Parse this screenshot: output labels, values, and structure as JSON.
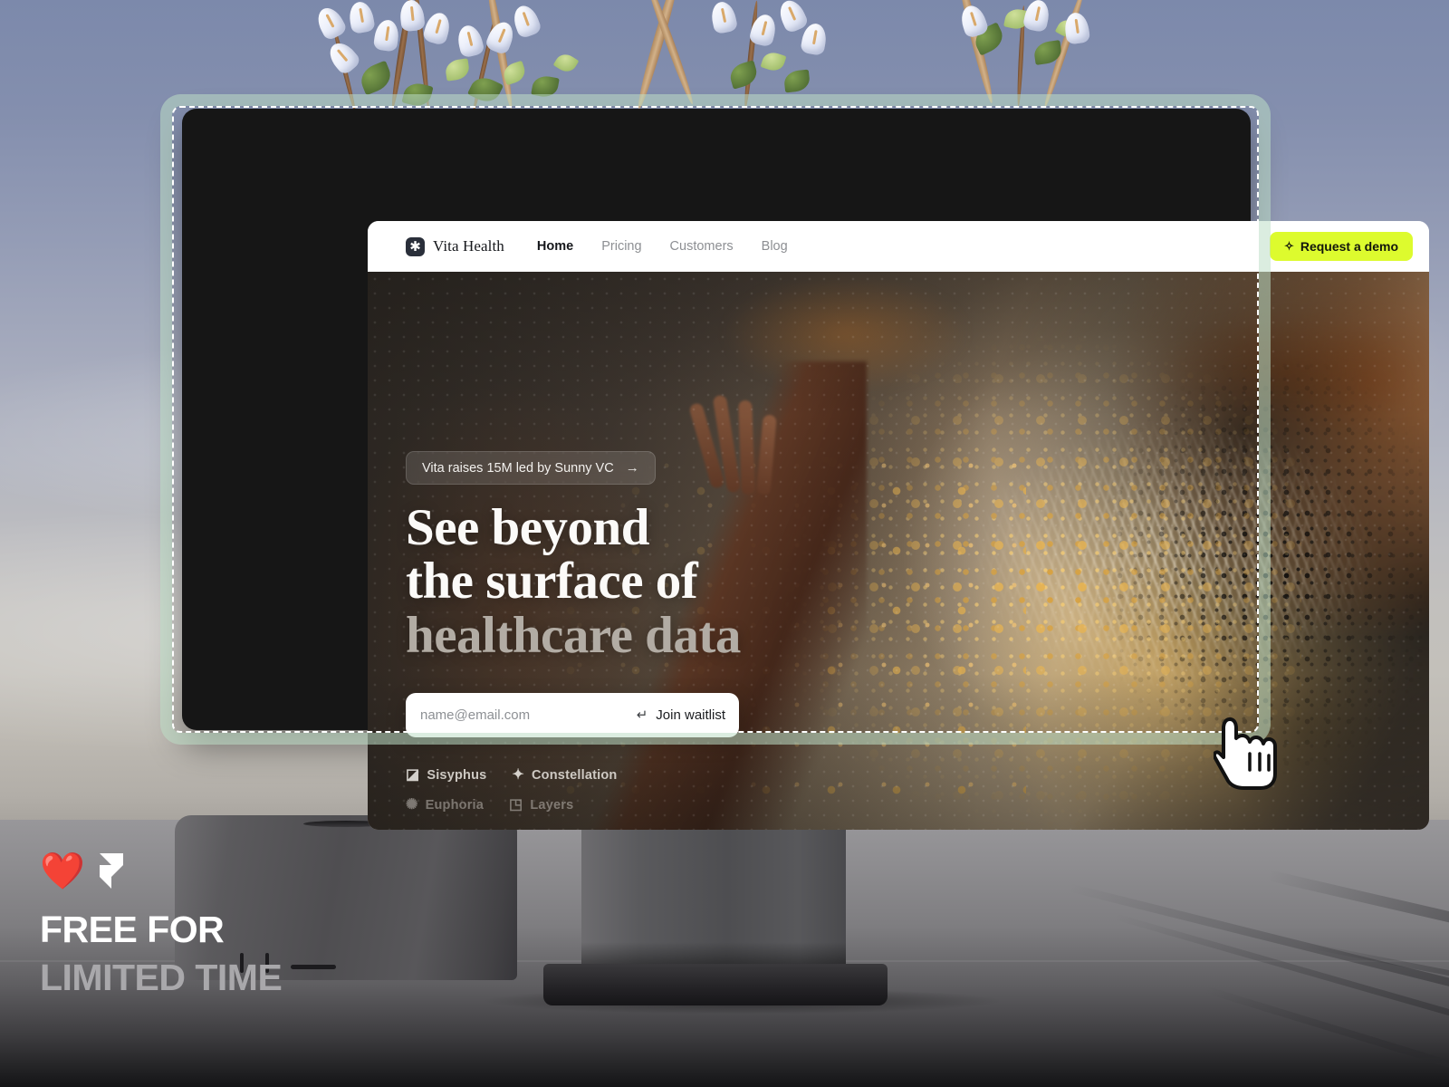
{
  "scene": {
    "description": "Studio display showing a website landing page, selected with a dashed marquee",
    "colors": {
      "sky_top": "#7c89ab",
      "sky_bottom": "#a9a59f",
      "floor": "#8d8c8f",
      "selection_border": "#ffffff",
      "selection_glow": "#bedec6",
      "accent_cta": "#ddfb2e"
    }
  },
  "site": {
    "nav": {
      "brand_mark_icon": "asterisk-icon",
      "brand_name": "Vita Health",
      "links": [
        {
          "label": "Home",
          "active": true
        },
        {
          "label": "Pricing",
          "active": false
        },
        {
          "label": "Customers",
          "active": false
        },
        {
          "label": "Blog",
          "active": false
        }
      ],
      "cta": {
        "label": "Request a demo",
        "icon": "sparkle-icon"
      }
    },
    "hero": {
      "announcement": {
        "text": "Vita raises 15M led by Sunny VC",
        "icon": "arrow-right-icon"
      },
      "headline_line1": "See beyond",
      "headline_line2": "the surface of",
      "headline_line3": "healthcare data",
      "waitlist": {
        "placeholder": "name@email.com",
        "value": "",
        "submit_label": "Join waitlist",
        "submit_icon": "enter-return-icon"
      },
      "logos": [
        {
          "name": "Sisyphus",
          "icon": "sisyphus-icon",
          "faded": false
        },
        {
          "name": "Constellation",
          "icon": "constellation-icon",
          "faded": false
        },
        {
          "name": "Euphoria",
          "icon": "euphoria-icon",
          "faded": true
        },
        {
          "name": "Layers",
          "icon": "layers-icon",
          "faded": true
        }
      ]
    }
  },
  "promo": {
    "heart_icon": "heart-emoji",
    "brand_icon": "framer-logo-icon",
    "line1": "FREE FOR",
    "line2": "LIMITED TIME"
  },
  "cursor": {
    "icon": "pointing-hand-cursor"
  }
}
